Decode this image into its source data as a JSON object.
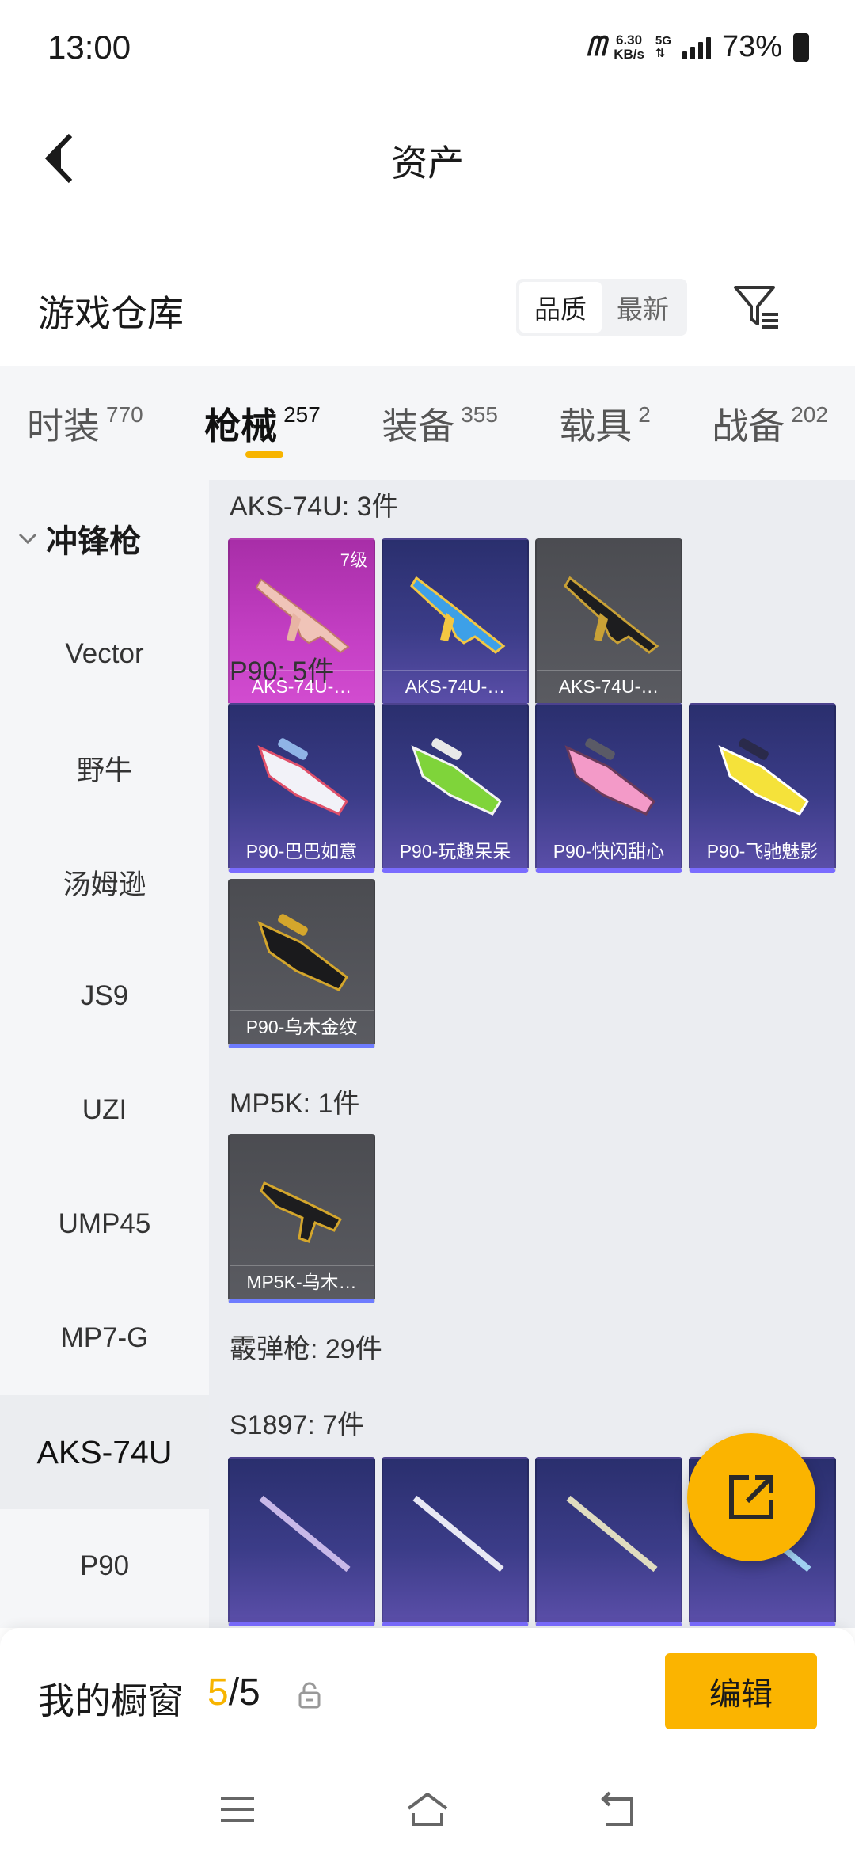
{
  "status_bar": {
    "time": "13:00",
    "net_logo": "ᗰ",
    "net_speed_value": "6.30",
    "net_speed_unit": "KB/s",
    "net_type": "5G",
    "battery_pct": "73%"
  },
  "header": {
    "title": "资产",
    "back_icon": "chevron-left-icon"
  },
  "warehouse": {
    "title": "游戏仓库",
    "sort_options": [
      "品质",
      "最新"
    ],
    "sort_selected": "品质",
    "filter_icon": "filter-icon"
  },
  "tabs": [
    {
      "label": "时装",
      "count": "770"
    },
    {
      "label": "枪械",
      "count": "257",
      "active": true
    },
    {
      "label": "装备",
      "count": "355"
    },
    {
      "label": "载具",
      "count": "2"
    },
    {
      "label": "战备",
      "count": "202"
    }
  ],
  "sidebar": {
    "category": "冲锋枪",
    "items": [
      "Vector",
      "野牛",
      "汤姆逊",
      "JS9",
      "UZI",
      "UMP45",
      "MP7-G",
      "AKS-74U",
      "P90"
    ],
    "active": "AKS-74U"
  },
  "groups": [
    {
      "title": "AKS-74U: 3件",
      "items": [
        {
          "name": "AKS-74U-…",
          "level": "7级",
          "rarity": "pink"
        },
        {
          "name": "AKS-74U-…",
          "rarity": "purple"
        },
        {
          "name": "AKS-74U-…",
          "rarity": "gray"
        }
      ]
    },
    {
      "title": "P90: 5件",
      "items": [
        {
          "name": "P90-巴巴如意",
          "rarity": "purple"
        },
        {
          "name": "P90-玩趣呆呆",
          "rarity": "purple"
        },
        {
          "name": "P90-快闪甜心",
          "rarity": "purple"
        },
        {
          "name": "P90-飞驰魅影",
          "rarity": "purple"
        },
        {
          "name": "P90-乌木金纹",
          "rarity": "gray"
        }
      ]
    },
    {
      "title": "MP5K: 1件",
      "items": [
        {
          "name": "MP5K-乌木…",
          "rarity": "gray"
        }
      ]
    },
    {
      "title": "霰弹枪: 29件",
      "items": []
    },
    {
      "title": "S1897: 7件",
      "items": [
        {
          "name": "",
          "rarity": "purple"
        },
        {
          "name": "",
          "rarity": "purple"
        },
        {
          "name": "",
          "rarity": "purple"
        },
        {
          "name": "",
          "rarity": "purple"
        }
      ]
    }
  ],
  "fab": {
    "icon": "share-external-icon"
  },
  "showcase": {
    "label": "我的橱窗",
    "current": "5",
    "separator": "/",
    "total": "5",
    "lock_icon": "lock-icon",
    "edit_label": "编辑"
  },
  "nav": {
    "menu_icon": "menu-icon",
    "home_icon": "home-icon",
    "back_icon": "back-icon"
  }
}
